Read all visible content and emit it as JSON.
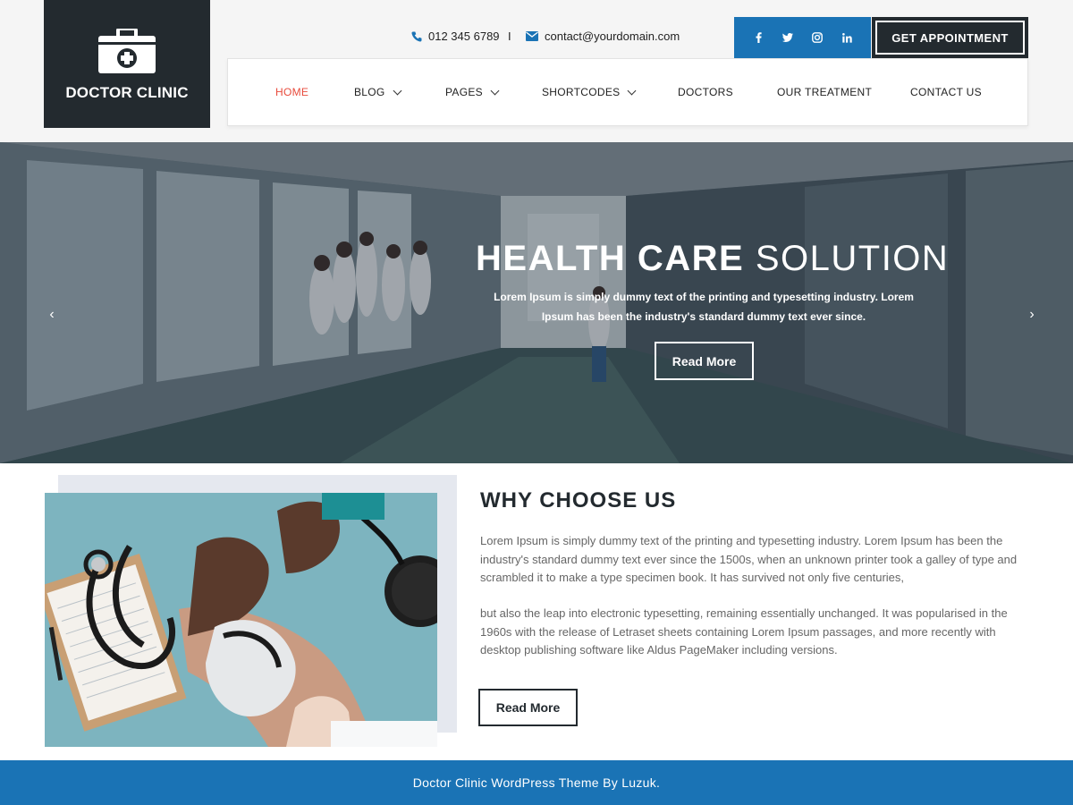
{
  "brand": {
    "name": "DOCTOR CLINIC",
    "logo_icon": "medical-kit-icon"
  },
  "topbar": {
    "phone": "012 345 6789",
    "separator": "I",
    "email": "contact@yourdomain.com",
    "social": [
      "f",
      "t",
      "ig",
      "in"
    ],
    "appointment_label": "GET APPOINTMENT"
  },
  "nav": {
    "items": [
      {
        "label": "HOME",
        "active": true
      },
      {
        "label": "BLOG",
        "dropdown": true
      },
      {
        "label": "PAGES",
        "dropdown": true
      },
      {
        "label": "SHORTCODES",
        "dropdown": true
      },
      {
        "label": "DOCTORS"
      },
      {
        "label": "OUR TREATMENT"
      },
      {
        "label": "CONTACT US"
      }
    ]
  },
  "hero": {
    "title_bold": "HEALTH CARE",
    "title_light": "SOLUTION",
    "text": "Lorem Ipsum is simply dummy text of the printing and typesetting industry. Lorem Ipsum has been the industry's standard dummy text ever since.",
    "button": "Read More",
    "prev_icon": "‹",
    "next_icon": "›"
  },
  "why": {
    "title": "WHY CHOOSE US",
    "p1": "Lorem Ipsum is simply dummy text of the printing and typesetting industry. Lorem Ipsum has been the industry's standard dummy text ever since the 1500s, when an unknown printer took a galley of type and scrambled it to make a type specimen book. It has survived not only five centuries,",
    "p2": "but also the leap into electronic typesetting, remaining essentially unchanged. It was popularised in the 1960s with the release of Letraset sheets containing Lorem Ipsum passages, and more recently with desktop publishing software like Aldus PageMaker including versions.",
    "button": "Read More"
  },
  "footer": {
    "text": "Doctor Clinic WordPress Theme By Luzuk."
  },
  "colors": {
    "dark": "#232a2f",
    "blue": "#1a73b5",
    "accent": "#e84b3c"
  }
}
